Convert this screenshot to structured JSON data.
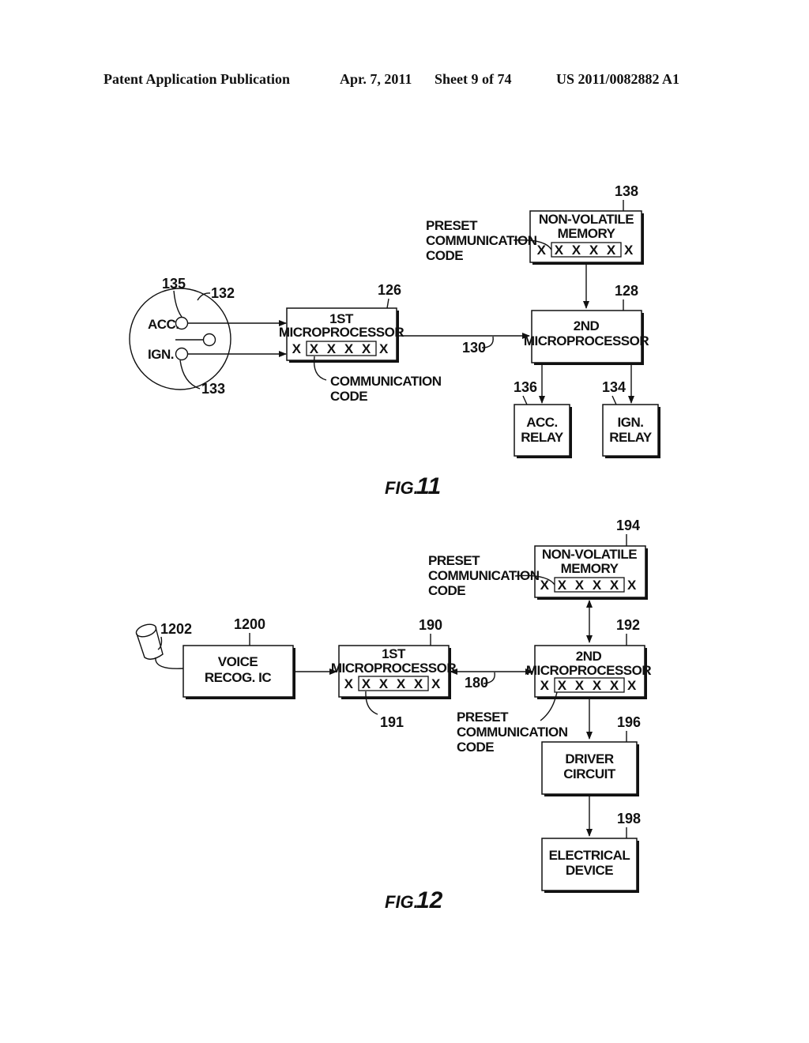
{
  "header": {
    "publication": "Patent Application Publication",
    "date": "Apr. 7, 2011",
    "sheet": "Sheet 9 of 74",
    "number": "US 2011/0082882 A1"
  },
  "fig11": {
    "caption_prefix": "FIG.",
    "caption_number": "11",
    "switch": {
      "ref": "132",
      "ref_acc": "135",
      "ref_ign": "133",
      "acc_label": "ACC.",
      "ign_label": "IGN."
    },
    "microprocessor1": {
      "ref": "126",
      "line1": "1ST",
      "line2": "MICROPROCESSOR",
      "code": "XXXXXX",
      "code_label_1": "COMMUNICATION",
      "code_label_2": "CODE"
    },
    "link": {
      "ref": "130"
    },
    "memory": {
      "ref": "138",
      "line1": "NON-VOLATILE",
      "line2": "MEMORY",
      "code": "XXXXXX",
      "preset_label_1": "PRESET",
      "preset_label_2": "COMMUNICATION",
      "preset_label_3": "CODE"
    },
    "microprocessor2": {
      "ref": "128",
      "line1": "2ND",
      "line2": "MICROPROCESSOR"
    },
    "acc_relay": {
      "ref": "136",
      "line1": "ACC.",
      "line2": "RELAY"
    },
    "ign_relay": {
      "ref": "134",
      "line1": "IGN.",
      "line2": "RELAY"
    }
  },
  "fig12": {
    "caption_prefix": "FIG.",
    "caption_number": "12",
    "microphone": {
      "ref": "1202"
    },
    "voice_ic": {
      "ref": "1200",
      "line1": "VOICE",
      "line2": "RECOG. IC"
    },
    "microprocessor1": {
      "ref": "190",
      "line1": "1ST",
      "line2": "MICROPROCESSOR",
      "code": "XXXXXX",
      "code_ref": "191"
    },
    "link": {
      "ref": "180"
    },
    "memory": {
      "ref": "194",
      "line1": "NON-VOLATILE",
      "line2": "MEMORY",
      "code": "XXXXXX",
      "preset_label_1": "PRESET",
      "preset_label_2": "COMMUNICATION",
      "preset_label_3": "CODE"
    },
    "microprocessor2": {
      "ref": "192",
      "line1": "2ND",
      "line2": "MICROPROCESSOR",
      "code": "XXXXXX",
      "preset_label_1": "PRESET",
      "preset_label_2": "COMMUNICATION",
      "preset_label_3": "CODE"
    },
    "driver": {
      "ref": "196",
      "line1": "DRIVER",
      "line2": "CIRCUIT"
    },
    "device": {
      "ref": "198",
      "line1": "ELECTRICAL",
      "line2": "DEVICE"
    }
  }
}
